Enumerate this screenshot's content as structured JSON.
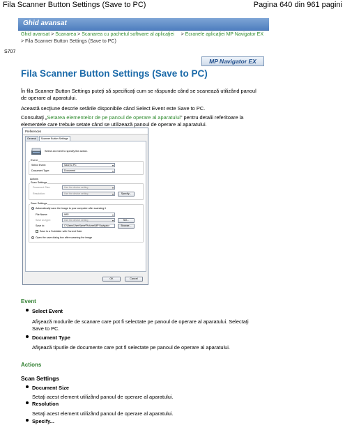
{
  "page_header": {
    "left": "Fila Scanner Button Settings (Save to PC)",
    "right": "Pagina 640 din 961 pagini"
  },
  "banner": "Ghid avansat",
  "breadcrumb": {
    "items": [
      "Ghid avansat",
      "Scanarea",
      "Scanarea cu pachetul software al aplicaţiei",
      "Ecranele aplicaţiei MP Navigator EX",
      "Fila Scanner Button Settings (Save to PC)"
    ],
    "separator": ">"
  },
  "section_id": "S707",
  "app_label": "MP Navigator EX",
  "title": "Fila Scanner Button Settings (Save to PC)",
  "intro": {
    "p1": "În fila Scanner Button Settings puteţi să specificaţi cum se răspunde când se scanează utilizând panoul de operare al aparatului.",
    "p2": "Această secţiune descrie setările disponibile când Select Event este Save to PC.",
    "p3_before": "Consultaţi „",
    "p3_link": "Setarea elementelor de pe panoul de operare al aparatului",
    "p3_after": "\" pentru detalii referitoare la elementele care trebuie setate când se utilizează panoul de operare al aparatului."
  },
  "dialog": {
    "title": "Preferences",
    "tabs": [
      "General",
      "Scanner Button Settings"
    ],
    "prompt": "Select an event to specify the action.",
    "event_group": "Event",
    "select_event_label": "Select Event:",
    "select_event_value": "Save to PC",
    "document_type_label": "Document Type:",
    "document_type_value": "Document",
    "actions_label": "Actions",
    "scan_settings_label": "Scan Settings",
    "doc_size_label": "Document Size:",
    "doc_size_value": "Use the device setting",
    "resolution_label": "Resolution:",
    "resolution_value": "Use the device setting",
    "specify_button": "Specify...",
    "save_settings_label": "Save Settings",
    "auto_save_label": "Automatically save the image to your computer after scanning it",
    "file_name_label": "File Name:",
    "file_name_value": "IMG",
    "save_as_type_label": "Save as type:",
    "save_as_type_value": "Use the device setting",
    "set_button": "Set...",
    "save_in_label": "Save in:",
    "save_in_value": "C:\\Users\\UserName\\Pictures\\MP Navigator",
    "browse_button": "Browse...",
    "subfolder_label": "Save to a Subfolder with Current Date",
    "open_dialog_label": "Open the save dialog box after scanning the image",
    "ok_button": "OK",
    "cancel_button": "Cancel"
  },
  "event_section": {
    "heading": "Event",
    "items": [
      {
        "title": "Select Event",
        "desc": "Afişează modurile de scanare care pot fi selectate pe panoul de operare al aparatului. Selectaţi Save to PC."
      },
      {
        "title": "Document Type",
        "desc": "Afişează tipurile de documente care pot fi selectate pe panoul de operare al aparatului."
      }
    ]
  },
  "actions_section": {
    "heading": "Actions",
    "sub_heading": "Scan Settings",
    "items": [
      {
        "title": "Document Size",
        "desc": "Setaţi acest element utilizând panoul de operare al aparatului."
      },
      {
        "title": "Resolution",
        "desc": "Setaţi acest element utilizând panoul de operare al aparatului."
      },
      {
        "title": "Specify...",
        "desc": ""
      }
    ]
  }
}
